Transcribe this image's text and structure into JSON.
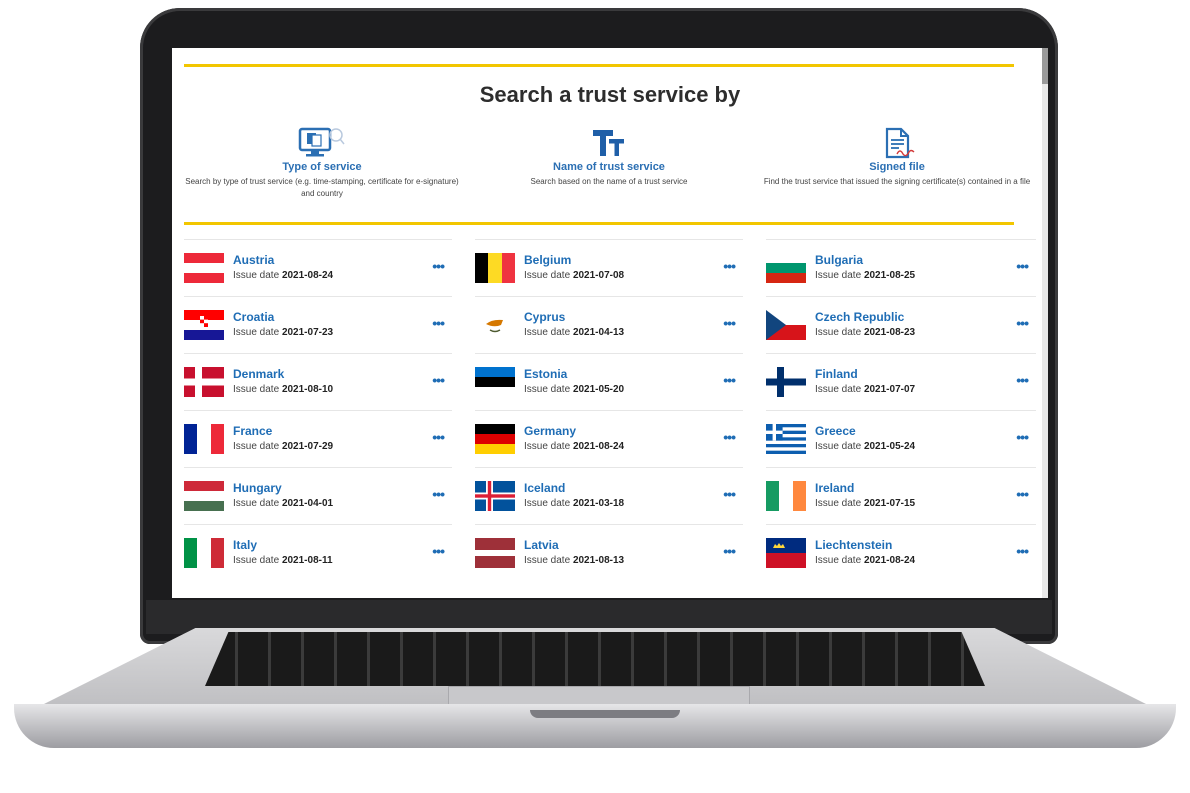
{
  "page": {
    "heading": "Search a trust service by",
    "options": [
      {
        "title": "Type of service",
        "description": "Search by type of trust service (e.g. time-stamping, certificate for e-signature) and country",
        "icon": "monitor-search-icon"
      },
      {
        "title": "Name of trust service",
        "description": "Search based on the name of a trust service",
        "icon": "text-size-icon"
      },
      {
        "title": "Signed file",
        "description": "Find the trust service that issued the signing certificate(s) contained in a file",
        "icon": "signed-document-icon"
      }
    ],
    "issue_label": "Issue date",
    "more_label": "•••"
  },
  "countries": [
    {
      "name": "Austria",
      "date": "2021-08-24",
      "flag": "austria"
    },
    {
      "name": "Belgium",
      "date": "2021-07-08",
      "flag": "belgium"
    },
    {
      "name": "Bulgaria",
      "date": "2021-08-25",
      "flag": "bulgaria"
    },
    {
      "name": "Croatia",
      "date": "2021-07-23",
      "flag": "croatia"
    },
    {
      "name": "Cyprus",
      "date": "2021-04-13",
      "flag": "cyprus"
    },
    {
      "name": "Czech Republic",
      "date": "2021-08-23",
      "flag": "czech"
    },
    {
      "name": "Denmark",
      "date": "2021-08-10",
      "flag": "denmark"
    },
    {
      "name": "Estonia",
      "date": "2021-05-20",
      "flag": "estonia"
    },
    {
      "name": "Finland",
      "date": "2021-07-07",
      "flag": "finland"
    },
    {
      "name": "France",
      "date": "2021-07-29",
      "flag": "france"
    },
    {
      "name": "Germany",
      "date": "2021-08-24",
      "flag": "germany"
    },
    {
      "name": "Greece",
      "date": "2021-05-24",
      "flag": "greece"
    },
    {
      "name": "Hungary",
      "date": "2021-04-01",
      "flag": "hungary"
    },
    {
      "name": "Iceland",
      "date": "2021-03-18",
      "flag": "iceland"
    },
    {
      "name": "Ireland",
      "date": "2021-07-15",
      "flag": "ireland"
    },
    {
      "name": "Italy",
      "date": "2021-08-11",
      "flag": "italy"
    },
    {
      "name": "Latvia",
      "date": "2021-08-13",
      "flag": "latvia"
    },
    {
      "name": "Liechtenstein",
      "date": "2021-08-24",
      "flag": "liechtenstein"
    }
  ],
  "colors": {
    "accent_yellow": "#f2c600",
    "link_blue": "#1f6db5",
    "heading": "#2d2d2d"
  }
}
